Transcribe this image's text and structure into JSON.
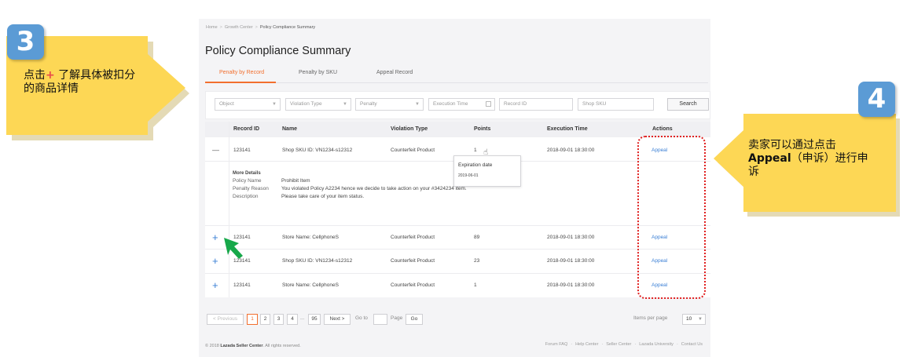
{
  "breadcrumb": [
    "Home",
    "Growth Center",
    "Policy Compliance Summary"
  ],
  "page_title": "Policy Compliance Summary",
  "tabs": [
    {
      "label": "Penalty by Record",
      "active": true
    },
    {
      "label": "Penalty by SKU",
      "active": false
    },
    {
      "label": "Appeal Record",
      "active": false
    }
  ],
  "filters": {
    "object": "Object",
    "violation_type": "Violation Type",
    "penalty": "Penalty",
    "execution_time": "Execution Time",
    "record_id": "Record ID",
    "shop_sku": "Shop SKU",
    "search_label": "Search"
  },
  "table": {
    "columns": [
      "Record ID",
      "Name",
      "Violation Type",
      "Points",
      "Execution Time",
      "Actions"
    ],
    "rows": [
      {
        "toggle": "—",
        "record_id": "123141",
        "name": "Shop SKU ID: VN1234-s12312",
        "violation": "Counterfeit Product",
        "points": "1",
        "time": "2018-09-01 18:30:00",
        "action": "Appeal"
      },
      {
        "toggle": "+",
        "record_id": "123141",
        "name": "Store Name: CellphoneS",
        "violation": "Counterfeit Product",
        "points": "89",
        "time": "2018-09-01 18:30:00",
        "action": "Appeal"
      },
      {
        "toggle": "+",
        "record_id": "123141",
        "name": "Shop SKU ID: VN1234-s12312",
        "violation": "Counterfeit Product",
        "points": "23",
        "time": "2018-09-01 18:30:00",
        "action": "Appeal"
      },
      {
        "toggle": "+",
        "record_id": "123141",
        "name": "Store Name: CellphoneS",
        "violation": "Counterfeit Product",
        "points": "1",
        "time": "2018-09-01 18:30:00",
        "action": "Appeal"
      }
    ],
    "details": {
      "heading": "More Details",
      "policy_name_label": "Policy Name",
      "policy_name": "Prohibit Item",
      "penalty_reason_label": "Penalty Reason",
      "penalty_reason": "You violated Policy A2234 hence we decide to take action on your #3424234 item.",
      "description_label": "Description",
      "description": "Please take care of your item status."
    },
    "tooltip": {
      "title": "Expiration date",
      "date": "2019-06-01"
    }
  },
  "pagination": {
    "previous": "< Previous",
    "pages": [
      "1",
      "2",
      "3",
      "4"
    ],
    "ellipsis": "...",
    "last": "95",
    "next": "Next >",
    "goto_label": "Go to",
    "goto_value": "",
    "page_label": "Page",
    "go": "Go",
    "items_per_page_label": "Items per page",
    "items_per_page": "10"
  },
  "footer": {
    "copyright_prefix": "© 2018 ",
    "brand": "Lazada Seller Center",
    "copyright_suffix": ". All rights reserved.",
    "links": [
      "Forum FAQ",
      "Help Center",
      "Seller Center",
      "Lazada University",
      "Contact Us"
    ]
  },
  "annotations": {
    "step3_number": "3",
    "step3_text_a": "点击",
    "step3_plus": "+",
    "step3_text_b": " 了解具体被扣分",
    "step3_text_c": "的商品详情",
    "step4_number": "4",
    "step4_text_a": "卖家可以通过点击",
    "step4_bold": "Appeal",
    "step4_text_b": "（申诉）进行申",
    "step4_text_c": "诉"
  },
  "colors": {
    "accent": "#f26f2e",
    "link": "#3a7fd5",
    "callout": "#fdd755",
    "badge": "#5b9bd5",
    "highlight_border": "#e02020",
    "pointer_arrow": "#17a84a"
  }
}
